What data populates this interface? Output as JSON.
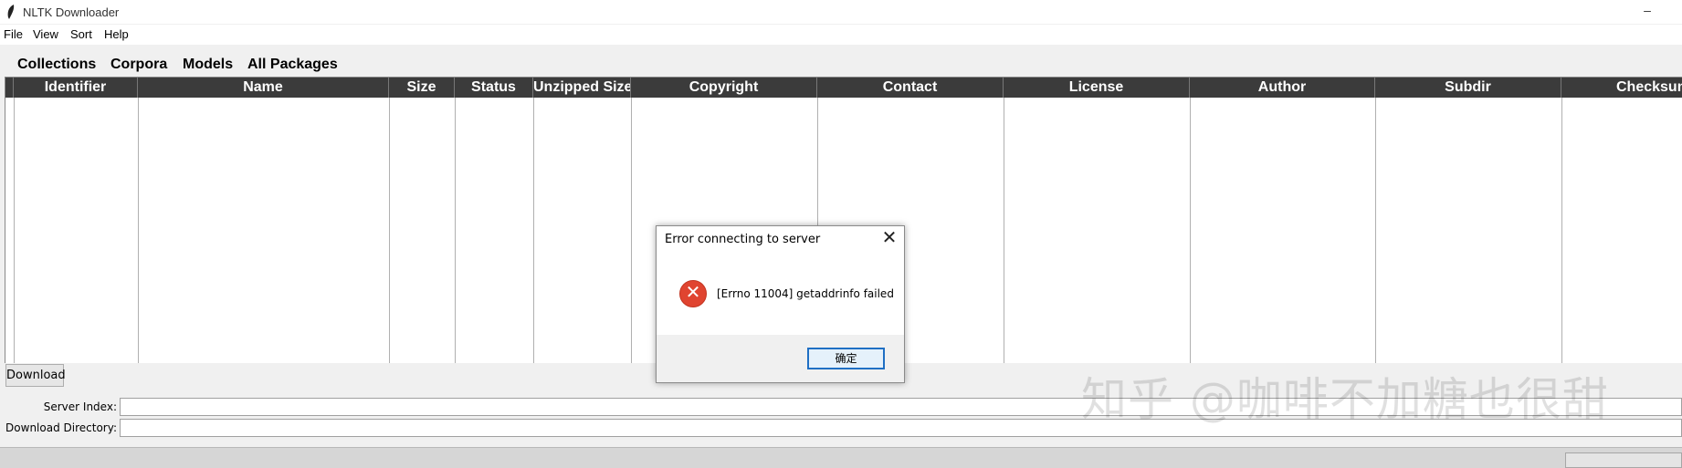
{
  "window": {
    "title": "NLTK Downloader",
    "minimize_glyph": "–",
    "icon": "feather-icon"
  },
  "menu": [
    "File",
    "View",
    "Sort",
    "Help"
  ],
  "tabs": [
    "Collections",
    "Corpora",
    "Models",
    "All Packages"
  ],
  "table": {
    "columns": [
      "Identifier",
      "Name",
      "Size",
      "Status",
      "Unzipped Size",
      "Copyright",
      "Contact",
      "License",
      "Author",
      "Subdir",
      "Checksum"
    ],
    "rows": []
  },
  "download_button": "Download",
  "fields": {
    "server_index": {
      "label": "Server Index:",
      "value": ""
    },
    "download_directory": {
      "label": "Download Directory:",
      "value": ""
    }
  },
  "dialog": {
    "title": "Error connecting to server",
    "close_glyph": "✕",
    "icon": "error-icon",
    "message": "[Errno 11004] getaddrinfo failed",
    "ok_label": "确定"
  },
  "watermark": "知乎 @咖啡不加糖也很甜",
  "colors": {
    "header_bg": "#3b3b3b",
    "error_red": "#e04430",
    "ok_border": "#1f6fc4"
  }
}
